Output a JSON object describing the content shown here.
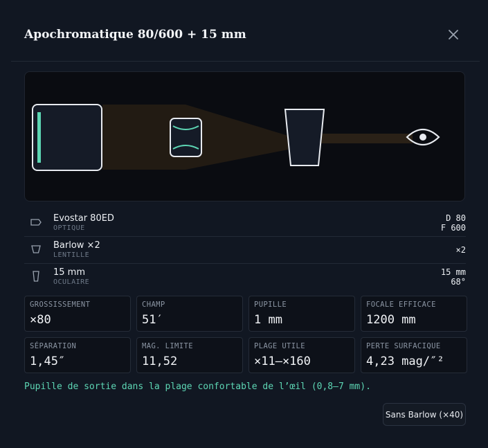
{
  "dialog": {
    "title": "Apochromatique 80/600 + 15 mm"
  },
  "optical_train": [
    {
      "name": "Evostar 80ED",
      "type": "OPTIQUE",
      "values": [
        "D 80",
        "F 600"
      ],
      "icon": "telescope-tube-icon"
    },
    {
      "name": "Barlow ×2",
      "type": "LENTILLE",
      "values": [
        "×2"
      ],
      "icon": "barlow-lens-icon"
    },
    {
      "name": "15 mm",
      "type": "OCULAIRE",
      "values": [
        "15 mm",
        "68°"
      ],
      "icon": "eyepiece-icon"
    }
  ],
  "stats": [
    {
      "label": "GROSSISSEMENT",
      "value": "×80"
    },
    {
      "label": "CHAMP",
      "value": "51′"
    },
    {
      "label": "PUPILLE",
      "value": "1 mm"
    },
    {
      "label": "FOCALE EFFICACE",
      "value": "1200 mm"
    },
    {
      "label": "SÉPARATION",
      "value": "1,45″"
    },
    {
      "label": "MAG. LIMITE",
      "value": "11,52"
    },
    {
      "label": "PLAGE UTILE",
      "value": "×11–×160"
    },
    {
      "label": "PERTE SURFACIQUE",
      "value": "4,23 mag/″²"
    }
  ],
  "note": "Pupille de sortie dans la plage confortable de l’œil (0,8–7 mm).",
  "actions": {
    "toggle_barlow_label": "Sans Barlow (×40)"
  },
  "colors": {
    "accent": "#5dd6b4",
    "beam": "#2a2117",
    "component_stroke": "#e8ebf0"
  }
}
